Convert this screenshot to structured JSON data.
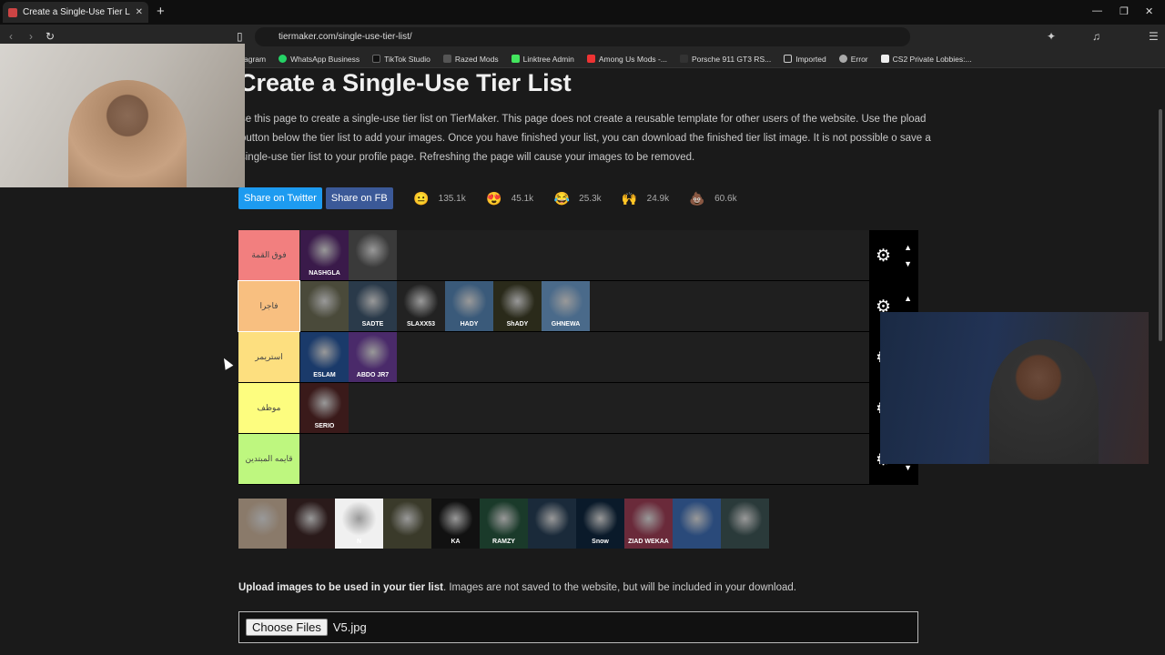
{
  "browser": {
    "tab_title": "Create a Single-Use Tier List (Pri",
    "new_tab": "+",
    "url": "tiermaker.com/single-use-tier-list/",
    "bookmarks": [
      "agram",
      "WhatsApp Business",
      "TikTok Studio",
      "Razed Mods",
      "Linktree Admin",
      "Among Us Mods -...",
      "Porsche 911 GT3 RS...",
      "Imported",
      "Error",
      "CS2 Private Lobbies:..."
    ]
  },
  "page": {
    "title": "Create a Single-Use Tier List",
    "description": "se this page to create a single-use tier list on TierMaker. This page does not create a reusable template for other users of the website. Use the pload button below the tier list to add your images. Once you have finished your list, you can download the finished tier list image. It is not possible o save a single-use tier list to your profile page. Refreshing the page will cause your images to be removed.",
    "share_twitter": "Share on Twitter",
    "share_fb": "Share on FB",
    "reactions": [
      {
        "icon": "neutral-face-icon",
        "glyph": "😐",
        "count": "135.1k"
      },
      {
        "icon": "heart-eyes-icon",
        "glyph": "😍",
        "count": "45.1k"
      },
      {
        "icon": "laughing-face-icon",
        "glyph": "😂",
        "count": "25.3k"
      },
      {
        "icon": "raised-hands-icon",
        "glyph": "🙌",
        "count": "24.9k"
      },
      {
        "icon": "poop-icon",
        "glyph": "💩",
        "count": "60.6k"
      }
    ]
  },
  "tiers": [
    {
      "label": "فوق القمة",
      "color": "#f27f7f",
      "images": [
        {
          "text": "NASHGLA",
          "bg": "#3a1a4a"
        },
        {
          "text": "",
          "bg": "#3a3a3a"
        }
      ]
    },
    {
      "label": "فاجرا",
      "color": "#f8bf80",
      "images": [
        {
          "text": "",
          "bg": "#4a4a3a"
        },
        {
          "text": "SADTE",
          "bg": "#2a3a4a"
        },
        {
          "text": "SLAXX53",
          "bg": "#222"
        },
        {
          "text": "HADY",
          "bg": "#3a5a7a"
        },
        {
          "text": "ShADY",
          "bg": "#2a2a1a"
        },
        {
          "text": "GHNEWA",
          "bg": "#4a6a8a"
        }
      ]
    },
    {
      "label": "استريمر",
      "color": "#fddf7f",
      "images": [
        {
          "text": "ESLAM",
          "bg": "#1a3a6a"
        },
        {
          "text": "ABDO JR7",
          "bg": "#4a2a6a"
        }
      ]
    },
    {
      "label": "موظف",
      "color": "#fdfd7f",
      "images": [
        {
          "text": "SERIO",
          "bg": "#3a1a1a"
        }
      ]
    },
    {
      "label": "قايمه المبتدين",
      "color": "#bef77f",
      "images": []
    }
  ],
  "pool": [
    {
      "text": "",
      "bg": "#8a7a6a"
    },
    {
      "text": "",
      "bg": "#2a1a1a"
    },
    {
      "text": "N",
      "bg": "#f0f0f0"
    },
    {
      "text": "",
      "bg": "#3a3a2a"
    },
    {
      "text": "KA",
      "bg": "#111"
    },
    {
      "text": "RAMZY",
      "bg": "#1a3a2a"
    },
    {
      "text": "",
      "bg": "#1a2a3a"
    },
    {
      "text": "Snow",
      "bg": "#0a1a2a"
    },
    {
      "text": "ZIAD WEKAA",
      "bg": "#6a2a3a"
    },
    {
      "text": "",
      "bg": "#2a4a7a"
    },
    {
      "text": "",
      "bg": "#2a3a3a"
    }
  ],
  "upload": {
    "bold": "Upload images to be used in your tier list",
    "rest": ". Images are not saved to the website, but will be included in your download.",
    "choose": "Choose Files",
    "filename": "V5.jpg"
  }
}
